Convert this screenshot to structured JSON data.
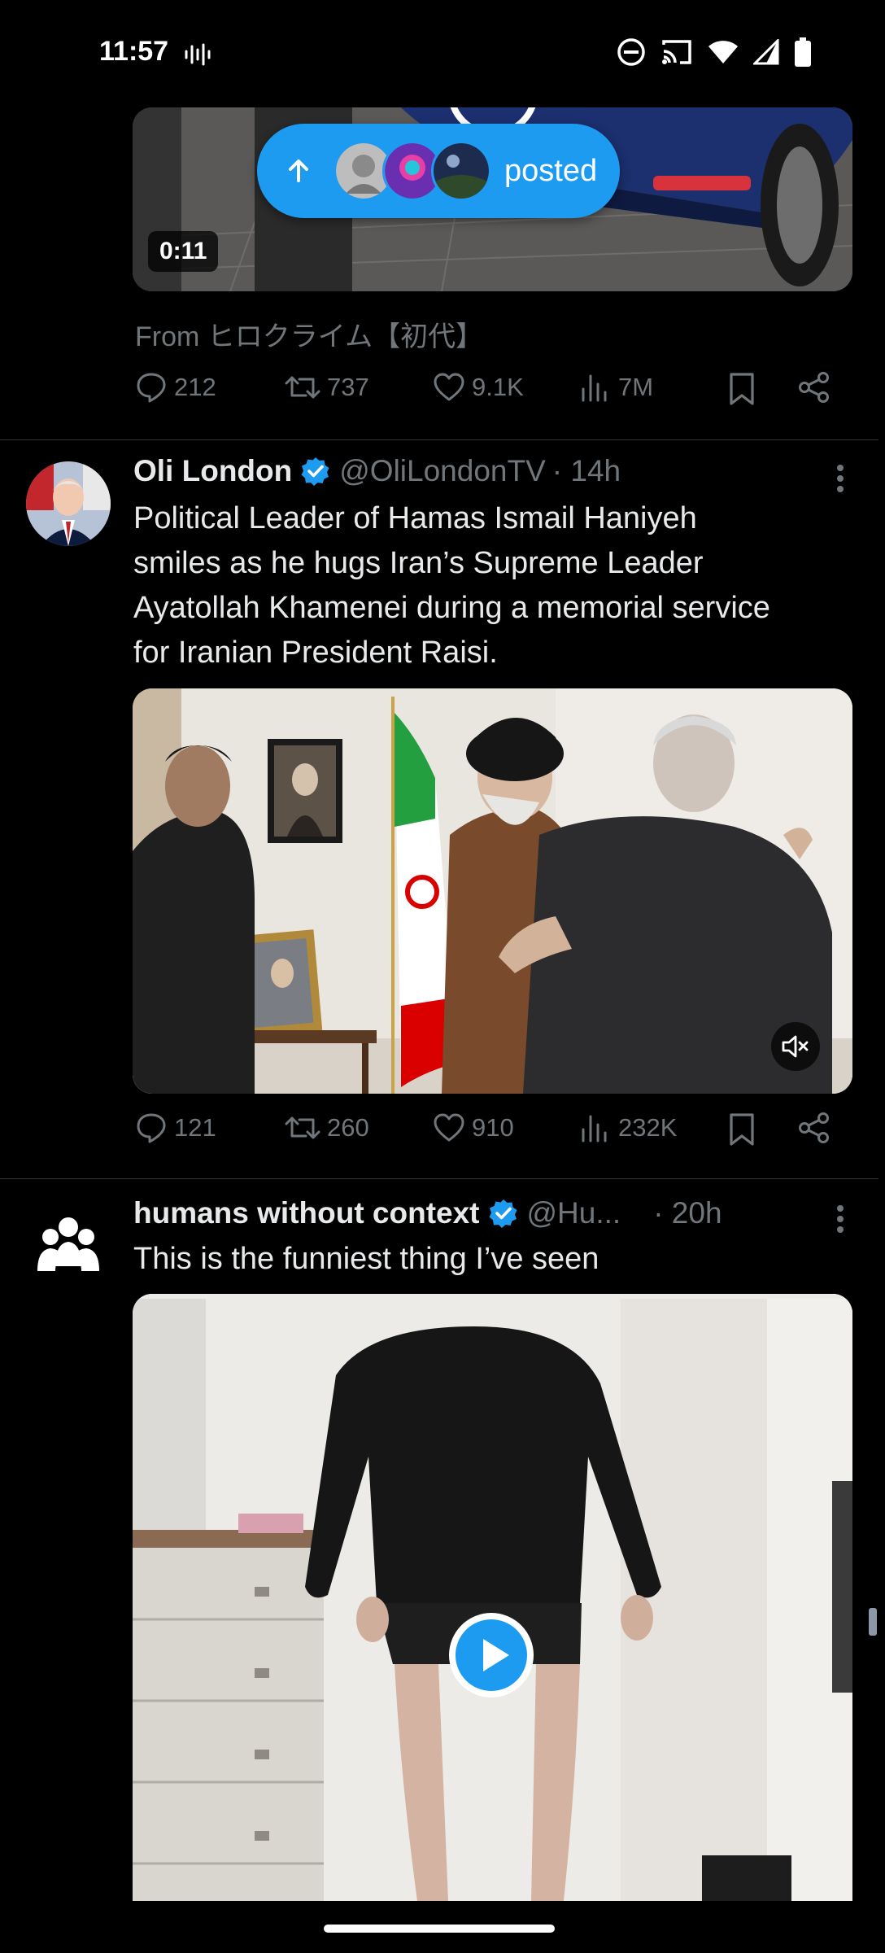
{
  "status_bar": {
    "time": "11:57",
    "icons": [
      "audio-wave-icon",
      "do-not-disturb-icon",
      "cast-icon",
      "wifi-icon",
      "signal-icon",
      "battery-icon"
    ]
  },
  "new_posts_pill": {
    "label": "posted",
    "icon": "arrow-up-icon"
  },
  "tweet1": {
    "video_duration": "0:11",
    "source": "From ヒロクライム【初代】",
    "actions": {
      "replies": "212",
      "retweets": "737",
      "likes": "9.1K",
      "views": "7M"
    }
  },
  "tweet2": {
    "name": "Oli London",
    "handle": "@OliLondonTV",
    "time": "· 14h",
    "text": "Political Leader of Hamas Ismail Haniyeh smiles as he hugs Iran’s Supreme Leader Ayatollah Khamenei during a memorial service for Iranian President Raisi.",
    "actions": {
      "replies": "121",
      "retweets": "260",
      "likes": "910",
      "views": "232K"
    },
    "media_icon": "mute-icon"
  },
  "tweet3": {
    "name": "humans without context",
    "handle": "@Hu...",
    "time": "· 20h",
    "text": "This is the funniest thing I’ve seen",
    "media_icon": "play-icon"
  },
  "colors": {
    "accent": "#1d9bf0",
    "muted": "#71767b",
    "divider": "#2f3336"
  }
}
